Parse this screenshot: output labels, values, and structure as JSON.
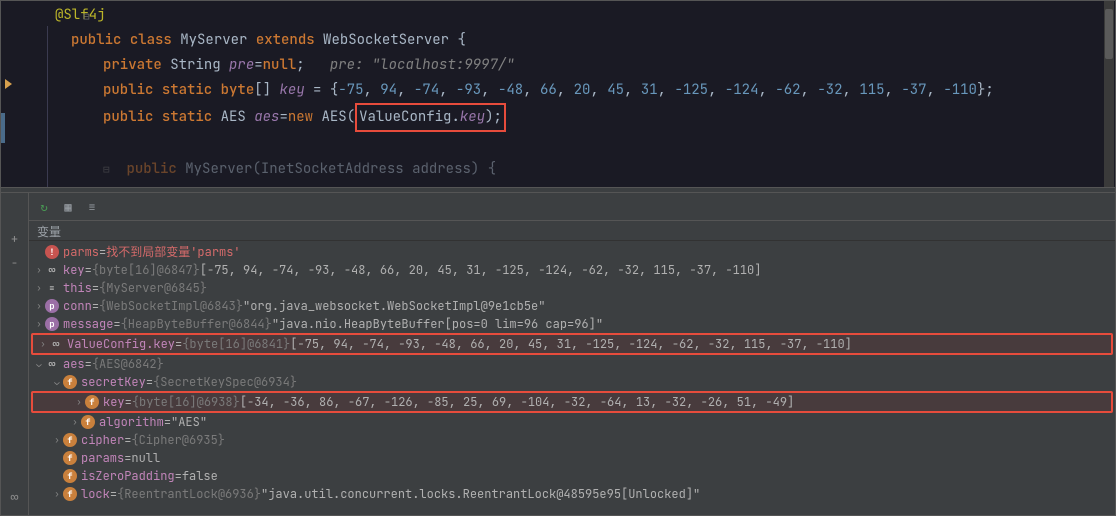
{
  "code": {
    "annotation": "@Slf4j",
    "line2": {
      "kw1": "public",
      "kw2": "class",
      "cls": "MyServer",
      "kw3": "extends",
      "sup": "WebSocketServer",
      "brace": " {"
    },
    "line3": {
      "kw1": "private",
      "type": "String",
      "fld": "pre",
      "eq": "=",
      "nul": "null",
      "semi": ";",
      "cmt": "pre: \"localhost:9997/\""
    },
    "line4": {
      "kw1": "public",
      "kw2": "static",
      "type": "byte",
      "br": "[]",
      "fld": "key",
      "eq": " = {",
      "nums": [
        "-75",
        "94",
        "-74",
        "-93",
        "-48",
        "66",
        "20",
        "45",
        "31",
        "-125",
        "-124",
        "-62",
        "-32",
        "115",
        "-37",
        "-110"
      ],
      "close": "};"
    },
    "line5": {
      "kw1": "public",
      "kw2": "static",
      "type": "AES",
      "fld": "aes",
      "eq": "=",
      "new": "new",
      "ctor": "AES",
      "argclass": "ValueConfig",
      "dot": ".",
      "argfld": "key",
      "close": ");"
    },
    "line7": {
      "kw1": "public",
      "ctor": "MyServer",
      "lp": "(",
      "ptype": "InetSocketAddress",
      "pname": "address",
      "rp": ") {"
    }
  },
  "debugger": {
    "header": "变量",
    "rows": [
      {
        "depth": 0,
        "arrow": "",
        "icon": "ib-red",
        "iconText": "!",
        "name": "parms",
        "op": " = ",
        "val": "找不到局部变量'parms'",
        "err": true
      },
      {
        "depth": 0,
        "arrow": "›",
        "icon": "ib-link",
        "iconText": "∞",
        "name": "key",
        "op": " = ",
        "type": "{byte[16]@6847}",
        "val": " [-75, 94, -74, -93, -48, 66, 20, 45, 31, -125, -124, -62, -32, 115, -37, -110]"
      },
      {
        "depth": 0,
        "arrow": "›",
        "icon": "",
        "iconText": "≡",
        "name": "this",
        "op": " = ",
        "type": "{MyServer@6845}"
      },
      {
        "depth": 0,
        "arrow": "›",
        "icon": "ib-purple",
        "iconText": "p",
        "name": "conn",
        "op": " = ",
        "type": "{WebSocketImpl@6843}",
        "val": " \"org.java_websocket.WebSocketImpl@9e1cb5e\""
      },
      {
        "depth": 0,
        "arrow": "›",
        "icon": "ib-purple",
        "iconText": "p",
        "name": "message",
        "op": " = ",
        "type": "{HeapByteBuffer@6844}",
        "val": " \"java.nio.HeapByteBuffer[pos=0 lim=96 cap=96]\""
      },
      {
        "depth": 0,
        "arrow": "›",
        "icon": "ib-link",
        "iconText": "∞",
        "name": "ValueConfig.key",
        "op": " = ",
        "type": "{byte[16]@6841}",
        "val": " [-75, 94, -74, -93, -48, 66, 20, 45, 31, -125, -124, -62, -32, 115, -37, -110]",
        "hl": true
      },
      {
        "depth": 0,
        "arrow": "⌄",
        "icon": "ib-link",
        "iconText": "∞",
        "name": "aes",
        "op": " = ",
        "type": "{AES@6842}"
      },
      {
        "depth": 1,
        "arrow": "⌄",
        "icon": "ib-orange",
        "iconText": "f",
        "name": "secretKey",
        "op": " = ",
        "type": "{SecretKeySpec@6934}"
      },
      {
        "depth": 2,
        "arrow": "›",
        "icon": "ib-orange",
        "iconText": "f",
        "name": "key",
        "op": " = ",
        "type": "{byte[16]@6938}",
        "val": " [-34, -36, 86, -67, -126, -85, 25, 69, -104, -32, -64, 13, -32, -26, 51, -49]",
        "hl": true
      },
      {
        "depth": 2,
        "arrow": "›",
        "icon": "ib-orange",
        "iconText": "f",
        "name": "algorithm",
        "op": " = ",
        "val": "\"AES\""
      },
      {
        "depth": 1,
        "arrow": "›",
        "icon": "ib-orange",
        "iconText": "f",
        "name": "cipher",
        "op": " = ",
        "type": "{Cipher@6935}"
      },
      {
        "depth": 1,
        "arrow": "",
        "icon": "ib-orange",
        "iconText": "f",
        "name": "params",
        "op": " = ",
        "val": "null"
      },
      {
        "depth": 1,
        "arrow": "",
        "icon": "ib-orange",
        "iconText": "f",
        "name": "isZeroPadding",
        "op": " = ",
        "val": "false"
      },
      {
        "depth": 1,
        "arrow": "›",
        "icon": "ib-orange",
        "iconText": "f",
        "name": "lock",
        "op": " = ",
        "type": "{ReentrantLock@6936}",
        "val": " \"java.util.concurrent.locks.ReentrantLock@48595e95[Unlocked]\""
      }
    ]
  }
}
